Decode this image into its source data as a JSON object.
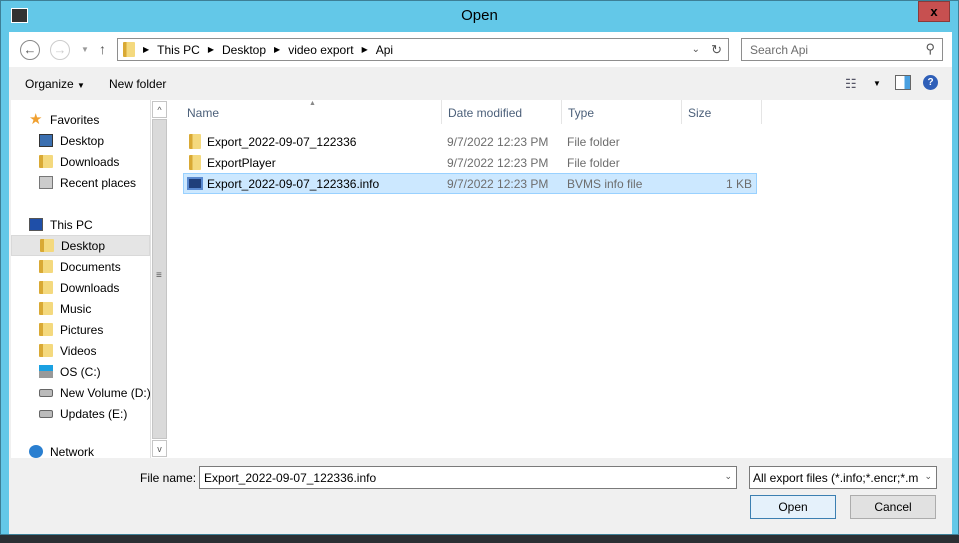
{
  "window": {
    "title": "Open",
    "close": "x"
  },
  "nav": {
    "back": "←",
    "forward": "→",
    "up": "↑",
    "breadcrumb": [
      "This PC",
      "Desktop",
      "video export",
      "Api"
    ],
    "search_placeholder": "Search Api"
  },
  "toolbar": {
    "organize": "Organize",
    "new_folder": "New folder"
  },
  "sidebar": {
    "favorites": "Favorites",
    "fav_items": [
      "Desktop",
      "Downloads",
      "Recent places"
    ],
    "this_pc": "This PC",
    "pc_items": [
      "Desktop",
      "Documents",
      "Downloads",
      "Music",
      "Pictures",
      "Videos",
      "OS (C:)",
      "New Volume (D:)",
      "Updates (E:)"
    ],
    "network": "Network",
    "selected": "Desktop"
  },
  "columns": {
    "name": "Name",
    "date": "Date modified",
    "type": "Type",
    "size": "Size"
  },
  "files": [
    {
      "name": "Export_2022-09-07_122336",
      "date": "9/7/2022 12:23 PM",
      "type": "File folder",
      "size": ""
    },
    {
      "name": "ExportPlayer",
      "date": "9/7/2022 12:23 PM",
      "type": "File folder",
      "size": ""
    },
    {
      "name": "Export_2022-09-07_122336.info",
      "date": "9/7/2022 12:23 PM",
      "type": "BVMS info file",
      "size": "1 KB"
    }
  ],
  "bottom": {
    "file_name_label": "File name:",
    "file_name": "Export_2022-09-07_122336.info",
    "file_type": "All export files (*.info;*.encr;*.m",
    "open": "Open",
    "cancel": "Cancel"
  }
}
